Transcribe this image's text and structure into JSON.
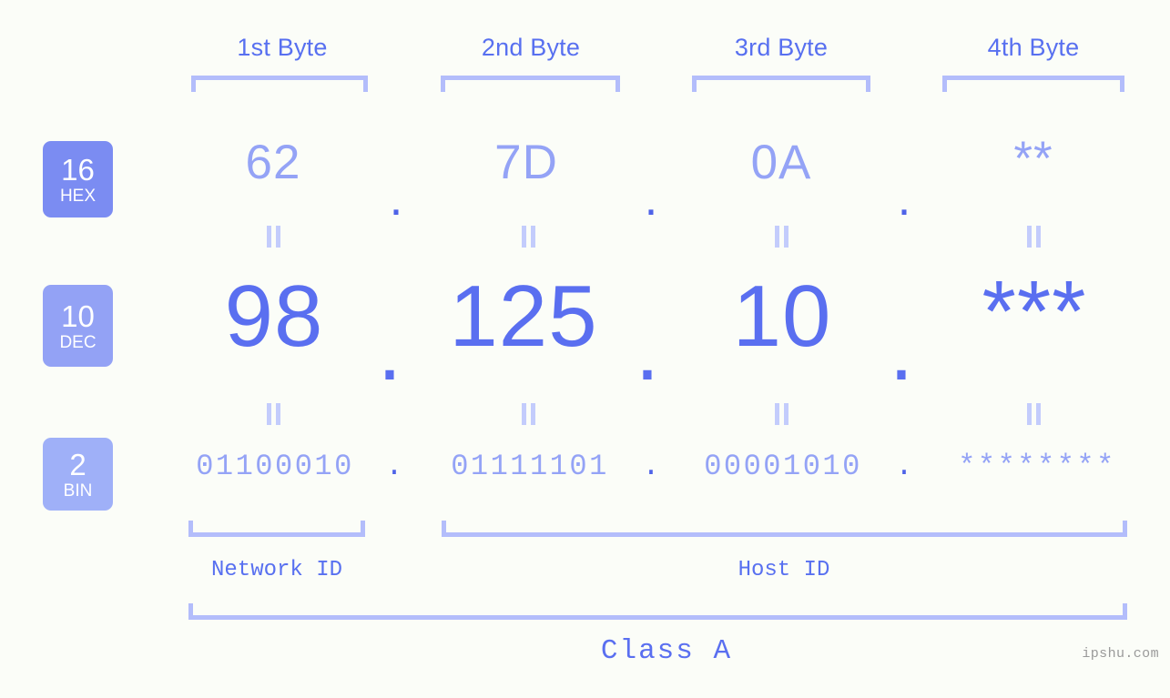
{
  "meta": {
    "watermark": "ipshu.com",
    "background": "#fbfdf8",
    "accent": "#5a6ff0",
    "accent_light": "#94a3f6",
    "bracket_color": "#b3bdfb"
  },
  "byte_headers": [
    {
      "label": "1st Byte"
    },
    {
      "label": "2nd Byte"
    },
    {
      "label": "3rd Byte"
    },
    {
      "label": "4th Byte"
    }
  ],
  "rows": [
    {
      "badge_number": "16",
      "badge_name": "HEX",
      "badge_color": "#7b8cf2",
      "values": [
        "62",
        "7D",
        "0A",
        "**"
      ],
      "separators": [
        ".",
        ".",
        "."
      ]
    },
    {
      "badge_number": "10",
      "badge_name": "DEC",
      "badge_color": "#93a2f5",
      "values": [
        "98",
        "125",
        "10",
        "***"
      ],
      "separators": [
        ".",
        ".",
        "."
      ]
    },
    {
      "badge_number": "2",
      "badge_name": "BIN",
      "badge_color": "#9fb0f8",
      "values": [
        "01100010",
        "01111101",
        "00001010",
        "********"
      ],
      "separators": [
        ".",
        ".",
        "."
      ]
    }
  ],
  "equals_marks": {
    "symbol": "=",
    "count_per_gap": 4,
    "gaps": 2
  },
  "groups": [
    {
      "label": "Network ID"
    },
    {
      "label": "Host ID"
    }
  ],
  "class": {
    "label": "Class A"
  }
}
